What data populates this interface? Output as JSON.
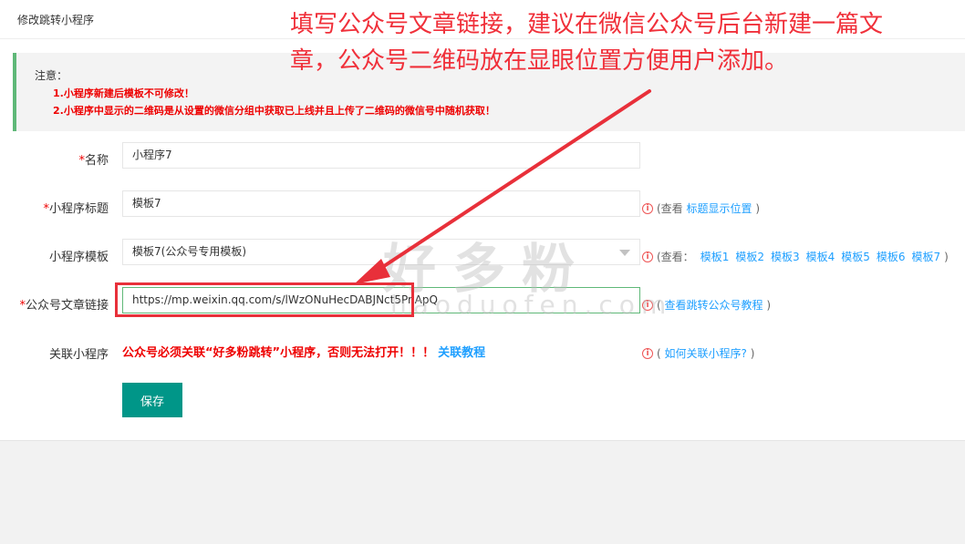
{
  "page_title": "修改跳转小程序",
  "notice": {
    "heading": "注意：",
    "line1": "1.小程序新建后模板不可修改！",
    "line2": "2.小程序中显示的二维码是从设置的微信分组中获取已上线并且上传了二维码的微信号中随机获取！"
  },
  "form": {
    "required_mark": "*",
    "name": {
      "label": "名称",
      "value": "小程序7"
    },
    "title": {
      "label": "小程序标题",
      "value": "模板7",
      "hint_prefix": "(查看",
      "hint_link": "标题显示位置",
      "hint_suffix": ")"
    },
    "template": {
      "label": "小程序模板",
      "value": "模板7(公众号专用模板)",
      "hint_prefix": "(查看：",
      "options": [
        "模板1",
        "模板2",
        "模板3",
        "模板4",
        "模板5",
        "模板6",
        "模板7"
      ],
      "hint_suffix": ")"
    },
    "article": {
      "label": "公众号文章链接",
      "value": "https://mp.weixin.qq.com/s/lWzONuHecDABJNct5PnApQ",
      "hint_prefix": "(",
      "hint_link": "查看跳转公众号教程",
      "hint_suffix": ")"
    },
    "relate": {
      "label": "关联小程序",
      "warning": "公众号必须关联“好多粉跳转”小程序，否则无法打开！！！",
      "link": "关联教程",
      "hint_prefix": "(",
      "hint_link": "如何关联小程序?",
      "hint_suffix": ")"
    },
    "save_label": "保存"
  },
  "callout": {
    "line1": "填写公众号文章链接，建议在微信公众号后台新建一篇文",
    "line2": "章，公众号二维码放在显眼位置方便用户添加。"
  },
  "watermark": {
    "main": "好多粉",
    "sub": "haoduofen.com"
  },
  "colors": {
    "accent": "#009688",
    "link": "#1e9fff",
    "warning": "#e00000",
    "notice_border": "#5fb878",
    "annotation": "#f0303a"
  },
  "icons": {
    "info": "info-circle-icon",
    "select": "chevron-down-icon",
    "arrow": "annotation-arrow-icon"
  }
}
